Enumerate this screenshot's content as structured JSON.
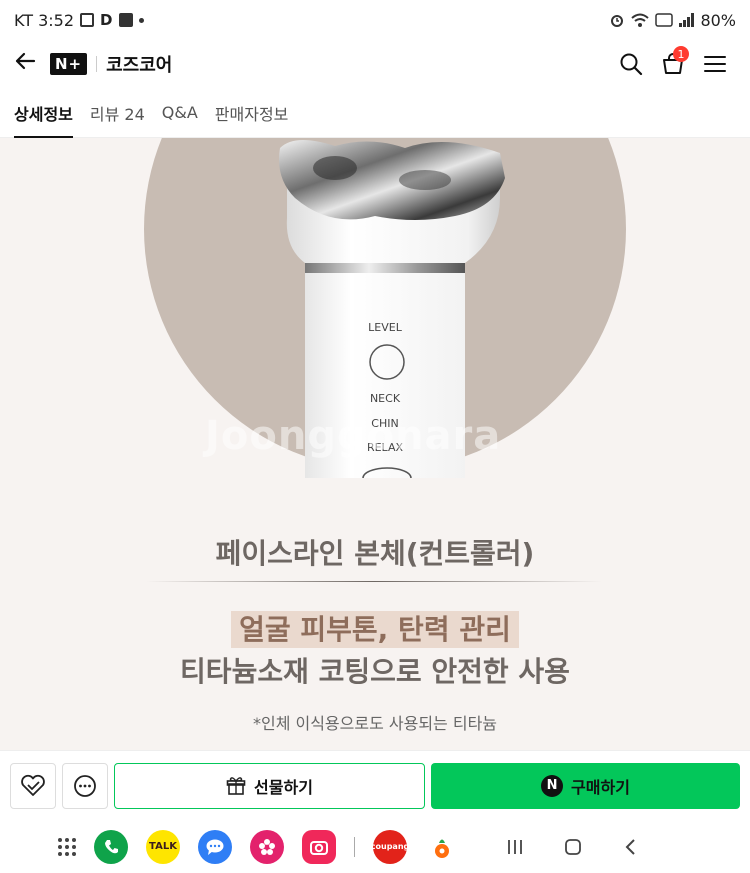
{
  "status_bar": {
    "carrier_time": "KT 3:52",
    "d_label": "D",
    "battery": "80%"
  },
  "header": {
    "brand_badge": "N+",
    "store_name": "코즈코어",
    "cart_count": "1"
  },
  "tabs": [
    {
      "label": "상세정보"
    },
    {
      "label": "리뷰 24"
    },
    {
      "label": "Q&A"
    },
    {
      "label": "판매자정보"
    }
  ],
  "product": {
    "device_labels": {
      "level": "LEVEL",
      "neck": "NECK",
      "chin": "CHIN",
      "relax": "RELAX"
    },
    "watermark": "Joonggonara",
    "headline": "페이스라인 본체(컨트롤러)",
    "highlight": "얼굴 피부톤, 탄력 관리",
    "subline": "티타늄소재 코팅으로 안전한 사용",
    "note": "*인체 이식용으로도 사용되는 티타늄"
  },
  "actions": {
    "gift_label": "선물하기",
    "buy_label": "구매하기",
    "buy_logo": "N"
  },
  "nav": {
    "kakao_label": "TALK",
    "coupang_label": "coupang"
  },
  "colors": {
    "naver_green": "#03c75a",
    "cart_badge": "#ff3b30"
  }
}
